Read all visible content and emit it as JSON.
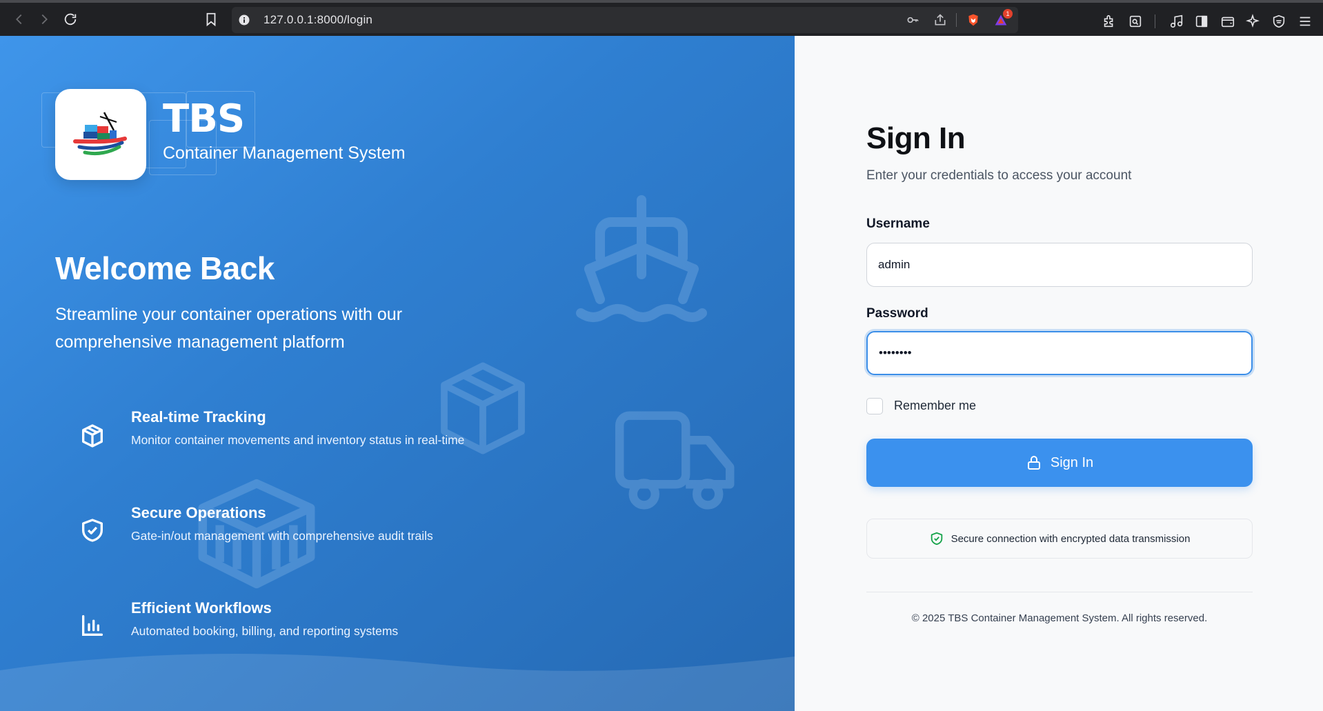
{
  "browser": {
    "url": "127.0.0.1:8000/login",
    "notification_count": "1"
  },
  "hero": {
    "brand": "TBS",
    "brand_subtitle": "Container Management System",
    "welcome": "Welcome Back",
    "intro": "Streamline your container operations with our comprehensive management platform",
    "features": [
      {
        "title": "Real-time Tracking",
        "description": "Monitor container movements and inventory status in real-time",
        "icon": "cube-icon"
      },
      {
        "title": "Secure Operations",
        "description": "Gate-in/out management with comprehensive audit trails",
        "icon": "shield-check-icon"
      },
      {
        "title": "Efficient Workflows",
        "description": "Automated booking, billing, and reporting systems",
        "icon": "bar-chart-icon"
      }
    ]
  },
  "form": {
    "title": "Sign In",
    "subtitle": "Enter your credentials to access your account",
    "username_label": "Username",
    "username_value": "admin",
    "password_label": "Password",
    "password_value": "••••••••",
    "remember_label": "Remember me",
    "submit_label": "Sign In",
    "secure_note": "Secure connection with encrypted data transmission",
    "copyright": "© 2025 TBS Container Management System. All rights reserved."
  },
  "colors": {
    "hero_start": "#3f95ea",
    "hero_end": "#2569b3",
    "primary": "#3b91ee",
    "secure_green": "#16a34a"
  }
}
